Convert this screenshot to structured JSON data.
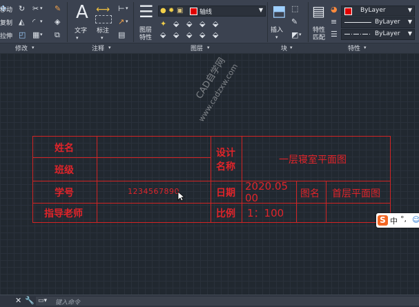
{
  "ribbon": {
    "modify": {
      "panel_label": "修改",
      "labels": [
        "移动",
        "复制",
        "拉伸"
      ]
    },
    "annotation": {
      "panel_label": "注释",
      "text_button": "文字",
      "dimension_button": "标注"
    },
    "layers": {
      "panel_label": "图层",
      "properties_button_line1": "图层",
      "properties_button_line2": "特性",
      "layer_dropdown": "轴线",
      "layer_color": "#e00000"
    },
    "block": {
      "panel_label": "块",
      "insert_button": "插入"
    },
    "properties": {
      "panel_label": "特性",
      "match_button_line1": "特性",
      "match_button_line2": "匹配",
      "color_dropdown": "ByLayer",
      "lineweight_dropdown": "ByLayer",
      "linetype_dropdown": "ByLayer"
    }
  },
  "title_block": {
    "row1_label": "姓名",
    "row2_label": "班级",
    "row3_label": "学号",
    "row3_value": "1234567890",
    "row4_label": "指导老师",
    "design_label_line1": "设计",
    "design_label_line2": "名称",
    "design_value": "一层寝室平面图",
    "date_label": "日期",
    "date_value_line1": "2020.05",
    "date_value_line2": "00",
    "drawing_name_label": "图名",
    "drawing_name_value": "首层平面图",
    "scale_label": "比例",
    "scale_value": "1：100"
  },
  "watermark": {
    "line1": "CAD自学网",
    "line2": "www.cadzxw.com"
  },
  "ime_toolbar": {
    "label": "中",
    "extra": "°,"
  },
  "command_line": {
    "placeholder": "键入命令"
  },
  "colors": {
    "drawing_red": "#e0242a",
    "canvas_bg": "#212830",
    "ribbon_bg": "#3b4250"
  }
}
